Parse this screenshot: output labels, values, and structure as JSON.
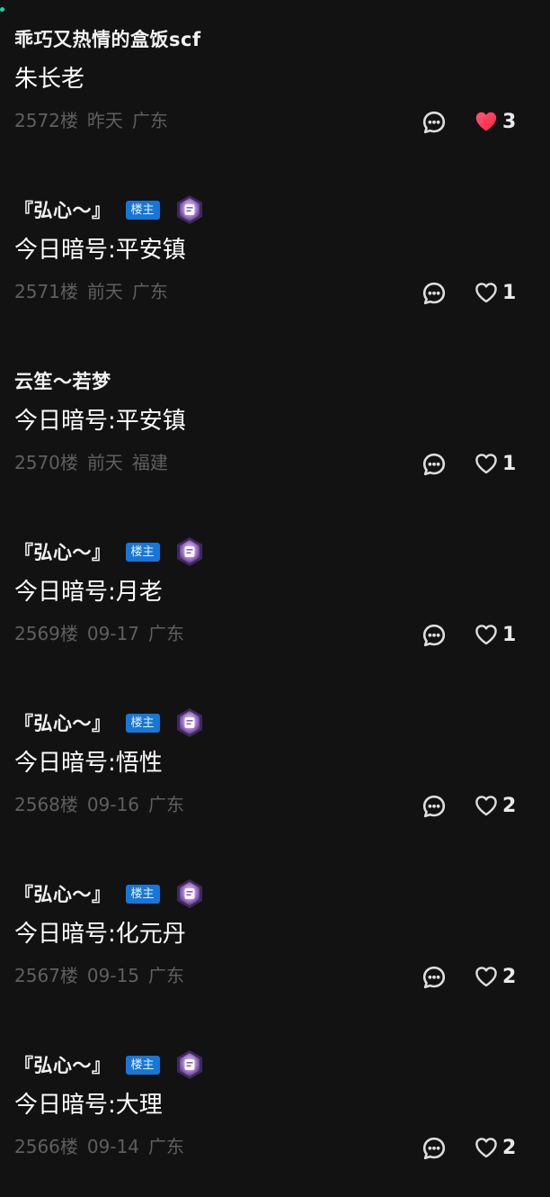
{
  "colors": {
    "background": "#121212",
    "accent_dot": "#1fd0a8",
    "op_badge": "#1677d8",
    "liked_heart": "#ff2d55",
    "muted_text": "#5f5f5f"
  },
  "comments": [
    {
      "username": "乖巧又热情的盒饭scf",
      "is_op": false,
      "content": "朱长老",
      "floor": "2572楼",
      "time": "昨天",
      "location": "广东",
      "likes": "3",
      "liked": true,
      "reply_icon": "comment-bubble-icon",
      "like_icon": "heart-filled-icon"
    },
    {
      "username": "『弘心～』",
      "is_op": true,
      "op_label": "楼主",
      "content": "今日暗号:平安镇",
      "floor": "2571楼",
      "time": "前天",
      "location": "广东",
      "likes": "1",
      "liked": false,
      "reply_icon": "comment-bubble-icon",
      "like_icon": "heart-outline-icon"
    },
    {
      "username": "云笙～若梦",
      "is_op": false,
      "content": "今日暗号:平安镇",
      "floor": "2570楼",
      "time": "前天",
      "location": "福建",
      "likes": "1",
      "liked": false,
      "reply_icon": "comment-bubble-icon",
      "like_icon": "heart-outline-icon"
    },
    {
      "username": "『弘心～』",
      "is_op": true,
      "op_label": "楼主",
      "content": "今日暗号:月老",
      "floor": "2569楼",
      "time": "09-17",
      "location": "广东",
      "likes": "1",
      "liked": false,
      "reply_icon": "comment-bubble-icon",
      "like_icon": "heart-outline-icon"
    },
    {
      "username": "『弘心～』",
      "is_op": true,
      "op_label": "楼主",
      "content": "今日暗号:悟性",
      "floor": "2568楼",
      "time": "09-16",
      "location": "广东",
      "likes": "2",
      "liked": false,
      "reply_icon": "comment-bubble-icon",
      "like_icon": "heart-outline-icon"
    },
    {
      "username": "『弘心～』",
      "is_op": true,
      "op_label": "楼主",
      "content": "今日暗号:化元丹",
      "floor": "2567楼",
      "time": "09-15",
      "location": "广东",
      "likes": "2",
      "liked": false,
      "reply_icon": "comment-bubble-icon",
      "like_icon": "heart-outline-icon"
    },
    {
      "username": "『弘心～』",
      "is_op": true,
      "op_label": "楼主",
      "content": "今日暗号:大理",
      "floor": "2566楼",
      "time": "09-14",
      "location": "广东",
      "likes": "2",
      "liked": false,
      "reply_icon": "comment-bubble-icon",
      "like_icon": "heart-outline-icon"
    }
  ]
}
